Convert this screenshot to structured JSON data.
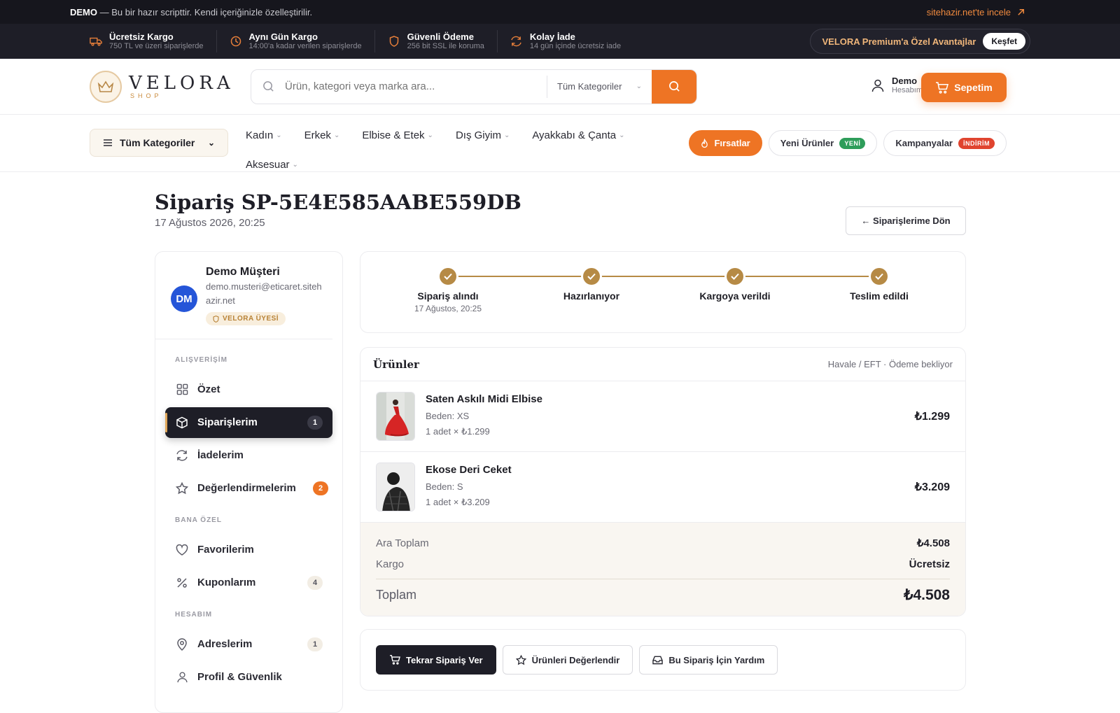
{
  "demo_bar": {
    "bold": "DEMO",
    "text": "— Bu bir hazır scripttir. Kendi içeriğinizle özelleştirilir.",
    "link": "sitehazir.net'te incele"
  },
  "features": [
    {
      "title": "Ücretsiz Kargo",
      "sub": "750 TL ve üzeri siparişlerde",
      "icon": "truck-icon"
    },
    {
      "title": "Aynı Gün Kargo",
      "sub": "14:00'a kadar verilen siparişlerde",
      "icon": "clock-icon"
    },
    {
      "title": "Güvenli Ödeme",
      "sub": "256 bit SSL ile koruma",
      "icon": "shield-icon"
    },
    {
      "title": "Kolay İade",
      "sub": "14 gün içinde ücretsiz iade",
      "icon": "refresh-icon"
    }
  ],
  "premium": {
    "text": "VELORA Premium'a Özel Avantajlar",
    "button": "Keşfet"
  },
  "logo": {
    "name": "VELORA",
    "sub": "SHOP"
  },
  "search": {
    "placeholder": "Ürün, kategori veya marka ara...",
    "category": "Tüm Kategoriler"
  },
  "account": {
    "name": "Demo",
    "sub": "Hesabım"
  },
  "cart": {
    "label": "Sepetim"
  },
  "nav": {
    "all_categories": "Tüm Kategoriler",
    "links": [
      "Kadın",
      "Erkek",
      "Elbise & Etek",
      "Dış Giyim",
      "Ayakkabı & Çanta",
      "Aksesuar"
    ],
    "deals": "Fırsatlar",
    "new_products": "Yeni Ürünler",
    "new_badge": "YENİ",
    "campaigns": "Kampanyalar",
    "discount_badge": "İNDİRİM"
  },
  "order": {
    "title": "Sipariş SP-5E4E585AABE559DB",
    "date": "17 Ağustos 2026, 20:25",
    "back": "← Siparişlerime Dön"
  },
  "profile": {
    "initials": "DM",
    "name": "Demo Müşteri",
    "email": "demo.musteri@eticaret.sitehazir.net",
    "member": "VELORA ÜYESİ"
  },
  "sidebar": {
    "sections": [
      {
        "title": "ALIŞVERİŞİM",
        "items": [
          {
            "label": "Özet",
            "icon": "grid-icon",
            "count": ""
          },
          {
            "label": "Siparişlerim",
            "icon": "box-icon",
            "count": "1"
          },
          {
            "label": "İadelerim",
            "icon": "refresh-icon",
            "count": ""
          },
          {
            "label": "Değerlendirmelerim",
            "icon": "star-icon",
            "count": "2"
          }
        ]
      },
      {
        "title": "BANA ÖZEL",
        "items": [
          {
            "label": "Favorilerim",
            "icon": "heart-icon",
            "count": ""
          },
          {
            "label": "Kuponlarım",
            "icon": "percent-icon",
            "count": "4"
          }
        ]
      },
      {
        "title": "HESABIM",
        "items": [
          {
            "label": "Adreslerim",
            "icon": "location-icon",
            "count": "1"
          },
          {
            "label": "Profil & Güvenlik",
            "icon": "user-icon",
            "count": ""
          }
        ]
      }
    ]
  },
  "steps": [
    {
      "label": "Sipariş alındı",
      "date": "17 Ağustos, 20:25"
    },
    {
      "label": "Hazırlanıyor",
      "date": ""
    },
    {
      "label": "Kargoya verildi",
      "date": ""
    },
    {
      "label": "Teslim edildi",
      "date": ""
    }
  ],
  "products": {
    "title": "Ürünler",
    "payment": "Havale / EFT · Ödeme bekliyor",
    "items": [
      {
        "name": "Saten Askılı Midi Elbise",
        "size": "Beden: XS",
        "qty": "1 adet × ₺1.299",
        "price": "₺1.299"
      },
      {
        "name": "Ekose Deri Ceket",
        "size": "Beden: S",
        "qty": "1 adet × ₺3.209",
        "price": "₺3.209"
      }
    ]
  },
  "totals": {
    "subtotal_label": "Ara Toplam",
    "subtotal": "₺4.508",
    "shipping_label": "Kargo",
    "shipping": "Ücretsiz",
    "total_label": "Toplam",
    "total": "₺4.508"
  },
  "actions": {
    "reorder": "Tekrar Sipariş Ver",
    "review": "Ürünleri Değerlendir",
    "help": "Bu Sipariş İçin Yardım"
  },
  "colors": {
    "accent": "#ee7424",
    "dark": "#1e1e27",
    "gold": "#b68a45"
  }
}
